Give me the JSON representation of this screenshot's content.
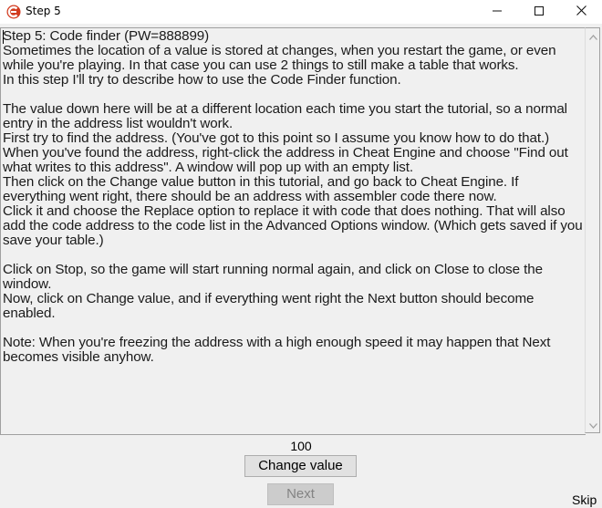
{
  "window": {
    "title": "Step 5",
    "icon": "cheat-engine-icon",
    "controls": {
      "minimize": "minimize-icon",
      "maximize": "maximize-icon",
      "close": "close-icon"
    }
  },
  "tutorial": {
    "text": "Step 5: Code finder (PW=888899)\nSometimes the location of a value is stored at changes, when you restart the game, or even while you're playing. In that case you can use 2 things to still make a table that works.\nIn this step I'll try to describe how to use the Code Finder function.\n\nThe value down here will be at a different location each time you start the tutorial, so a normal entry in the address list wouldn't work.\nFirst try to find the address. (You've got to this point so I assume you know how to do that.)\nWhen you've found the address, right-click the address in Cheat Engine and choose \"Find out what writes to this address\". A window will pop up with an empty list.\nThen click on the Change value button in this tutorial, and go back to Cheat Engine. If everything went right, there should be an address with assembler code there now.\nClick it and choose the Replace option to replace it with code that does nothing. That will also add the code address to the code list in the Advanced Options window. (Which gets saved if you save your table.)\n\nClick on Stop, so the game will start running normal again, and click on Close to close the window.\nNow, click on Change value, and if everything went right the Next button should become enabled.\n\nNote: When you're freezing the address with a high enough speed it may happen that Next becomes visible anyhow."
  },
  "value": "100",
  "buttons": {
    "change_value": "Change value",
    "next": "Next",
    "skip": "Skip"
  }
}
